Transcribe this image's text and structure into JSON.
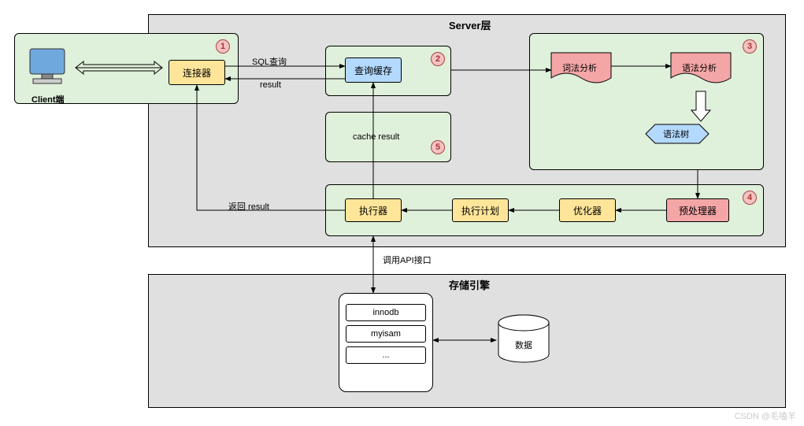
{
  "client": {
    "label": "Client端"
  },
  "server": {
    "label": "Server层",
    "connector": "连接器",
    "query_cache": "查询缓存",
    "lexical": "词法分析",
    "syntax": "语法分析",
    "syntax_tree": "语法树",
    "executor": "执行器",
    "exec_plan": "执行计划",
    "optimizer": "优化器",
    "preprocessor": "预处理器"
  },
  "edges": {
    "sql_query": "SQL查询",
    "result": "result",
    "cache_result": "cache result",
    "return_result": "返回 result",
    "api_call": "调用API接口"
  },
  "badges": {
    "b1": "1",
    "b2": "2",
    "b3": "3",
    "b4": "4",
    "b5": "5"
  },
  "storage": {
    "label": "存储引擎",
    "innodb": "innodb",
    "myisam": "myisam",
    "etc": "...",
    "data": "数据"
  },
  "watermark": "CSDN @毛嗑羊"
}
